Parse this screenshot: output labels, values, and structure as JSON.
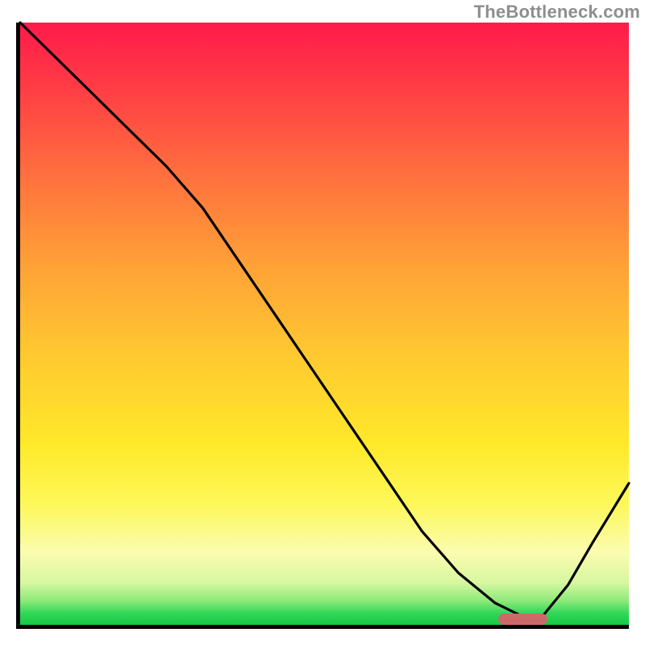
{
  "watermark": "TheBottleneck.com",
  "colors": {
    "gradient_top": "#ff1a4b",
    "gradient_bottom": "#14c943",
    "axis": "#000000",
    "curve": "#000000",
    "marker": "#cc6a6a",
    "watermark_text": "#8e8e8e"
  },
  "chart_data": {
    "type": "line",
    "title": "",
    "xlabel": "",
    "ylabel": "",
    "xlim": [
      0,
      100
    ],
    "ylim": [
      0,
      100
    ],
    "grid": false,
    "legend": false,
    "x": [
      0,
      6,
      12,
      18,
      24,
      30,
      36,
      42,
      48,
      54,
      60,
      66,
      72,
      78,
      82,
      86,
      90,
      94,
      100
    ],
    "y": [
      100,
      94,
      88,
      82,
      76,
      69,
      60,
      51,
      42,
      33,
      24,
      15,
      8,
      3,
      1,
      1,
      6,
      13,
      23
    ],
    "marker": {
      "x_start": 78,
      "x_end": 86,
      "y": 1.0
    }
  }
}
